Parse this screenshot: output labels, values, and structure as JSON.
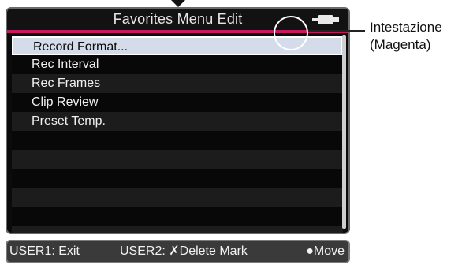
{
  "header": {
    "title": "Favorites Menu Edit",
    "battery_icon": "battery-plug-icon",
    "accent_color": "#c8185f"
  },
  "menu": {
    "items": [
      {
        "label": "Record Format..."
      },
      {
        "label": "Rec Interval"
      },
      {
        "label": "Rec Frames"
      },
      {
        "label": "Clip Review"
      },
      {
        "label": "Preset Temp."
      },
      {
        "label": ""
      },
      {
        "label": ""
      },
      {
        "label": ""
      },
      {
        "label": ""
      },
      {
        "label": ""
      },
      {
        "label": ""
      }
    ],
    "selected_index": 0
  },
  "callout": {
    "line1": "Intestazione",
    "line2": "(Magenta)"
  },
  "footer": {
    "user1": "USER1: Exit",
    "user2": "USER2: ✗Delete Mark",
    "move": "●Move"
  }
}
